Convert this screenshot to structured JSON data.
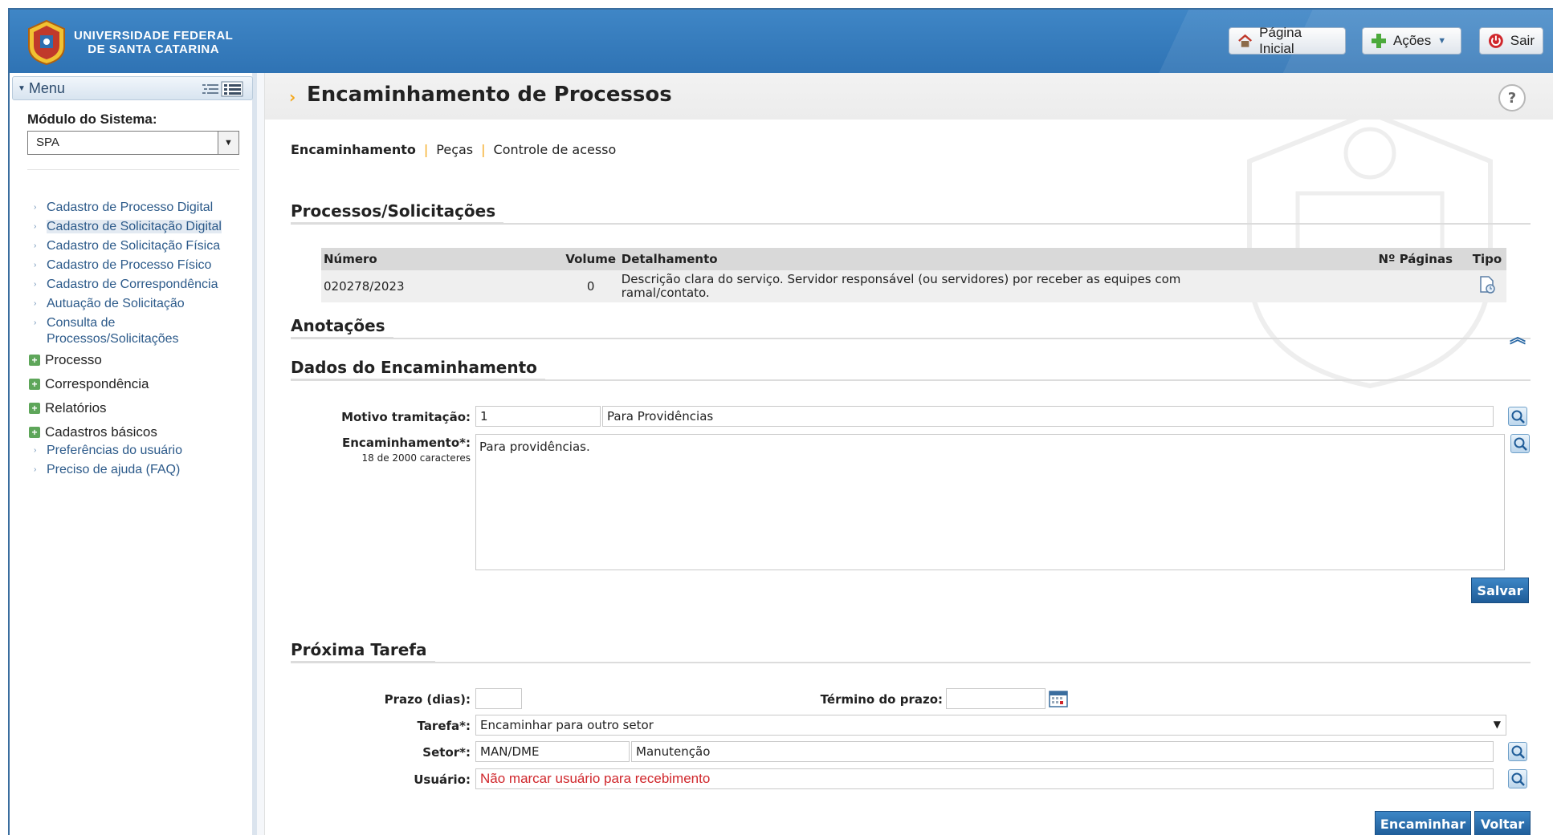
{
  "header": {
    "brand_line1": "UNIVERSIDADE FEDERAL",
    "brand_line2": "DE SANTA CATARINA",
    "btn_home": "Página Inicial",
    "btn_actions": "Ações",
    "btn_exit": "Sair"
  },
  "sidebar": {
    "menu_label": "Menu",
    "module_label": "Módulo do Sistema:",
    "module_value": "SPA",
    "links": [
      "Cadastro de Processo Digital",
      "Cadastro de Solicitação Digital",
      "Cadastro de Solicitação Física",
      "Cadastro de Processo Físico",
      "Cadastro de Correspondência",
      "Autuação de Solicitação",
      "Consulta de Processos/Solicitações"
    ],
    "groups": [
      "Processo",
      "Correspondência",
      "Relatórios",
      "Cadastros básicos"
    ],
    "extra_links": [
      "Preferências do usuário",
      "Preciso de ajuda (FAQ)"
    ]
  },
  "main": {
    "title": "Encaminhamento de Processos",
    "tabs": [
      "Encaminhamento",
      "Peças",
      "Controle de acesso"
    ],
    "sections": {
      "processos": "Processos/Solicitações",
      "anotacoes": "Anotações",
      "dados": "Dados do Encaminhamento",
      "proxima": "Próxima Tarefa"
    },
    "table": {
      "headers": [
        "Número",
        "Volume",
        "Detalhamento",
        "Nº Páginas",
        "Tipo"
      ],
      "rows": [
        {
          "numero": "020278/2023",
          "volume": "0",
          "detalhamento_l1": "Descrição clara do serviço. Servidor responsável (ou servidores) por receber as equipes com",
          "detalhamento_l2": "ramal/contato.",
          "paginas": ""
        }
      ]
    },
    "form": {
      "motivo_label": "Motivo tramitação:",
      "motivo_code": "1",
      "motivo_desc": "Para Providências",
      "encaminhamento_label": "Encaminhamento*:",
      "char_count": "18 de 2000 caracteres",
      "encaminhamento_value": "Para providências.",
      "save_label": "Salvar"
    },
    "next": {
      "prazo_label": "Prazo (dias):",
      "prazo_value": "",
      "termino_label": "Término do prazo:",
      "termino_value": "",
      "tarefa_label": "Tarefa*:",
      "tarefa_value": "Encaminhar para outro setor",
      "setor_label": "Setor*:",
      "setor_code": "MAN/DME",
      "setor_desc": "Manutenção",
      "usuario_label": "Usuário:",
      "usuario_value": "Não marcar usuário para recebimento",
      "btn_forward": "Encaminhar",
      "btn_back": "Voltar"
    }
  },
  "colors": {
    "header_blue": "#3f86c6",
    "accent_orange": "#f4a81b",
    "link_blue": "#2c5a8a",
    "warning_red": "#d0262b"
  }
}
